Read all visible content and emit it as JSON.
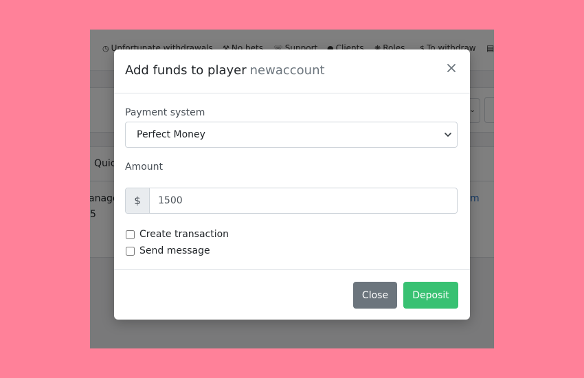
{
  "background_app": {
    "nav_items": [
      {
        "icon": "clock-icon",
        "label": "Unfortunate withdrawals"
      },
      {
        "icon": "hammer-icon",
        "label": "No bets"
      },
      {
        "icon": "headset-icon",
        "label": "Support"
      },
      {
        "icon": "user-icon",
        "label": "Clients"
      },
      {
        "icon": "roles-icon",
        "label": "Roles"
      },
      {
        "icon": "dollar-icon",
        "label": "To withdraw"
      }
    ],
    "content": {
      "tab_fragment": "Quic",
      "row_fragment_1": "anage",
      "row_fragment_2": "5",
      "link_fragment": "m"
    }
  },
  "modal": {
    "title": "Add funds to player",
    "player": "newaccount",
    "payment_system_label": "Payment system",
    "payment_system_value": "Perfect Money",
    "amount_label": "Amount",
    "currency_symbol": "$",
    "amount_value": "1500",
    "checkboxes": [
      {
        "label": "Create transaction",
        "checked": false
      },
      {
        "label": "Send message",
        "checked": false
      }
    ],
    "close_button": "Close",
    "deposit_button": "Deposit"
  },
  "colors": {
    "page_background": "#ff8199",
    "deposit_button": "#38c172",
    "close_button": "#6c757d",
    "player_name": "#6c757d"
  }
}
